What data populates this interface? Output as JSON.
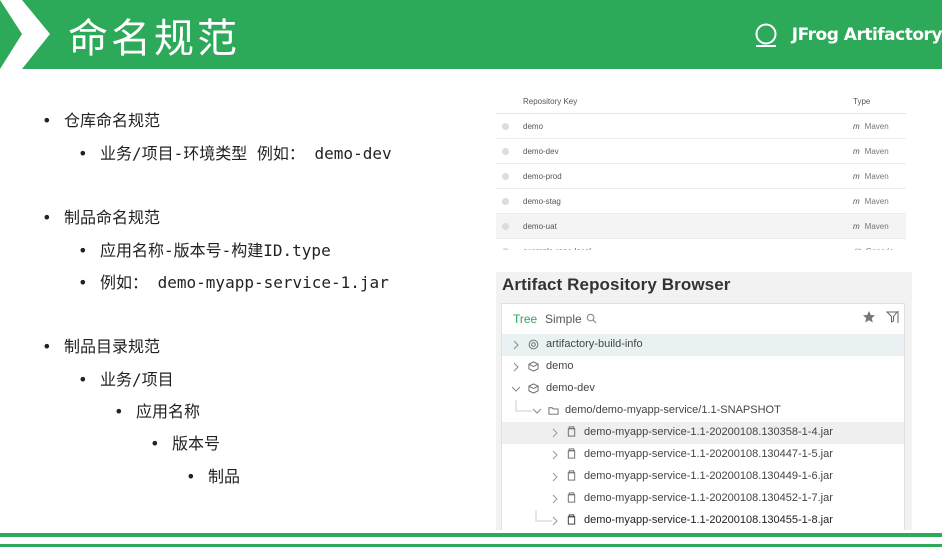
{
  "header": {
    "title": "命名规范",
    "brand": "JFrog Artifactory",
    "accent": "#2da95a"
  },
  "bullets": [
    {
      "text": "仓库命名规范"
    },
    {
      "text": "业务/项目-环境类型   例如： demo-dev"
    },
    {
      "text": "制品命名规范"
    },
    {
      "text": "应用名称-版本号-构建ID.type"
    },
    {
      "text": "例如： demo-myapp-service-1.jar"
    },
    {
      "text": "制品目录规范"
    },
    {
      "text": "业务/项目"
    },
    {
      "text": "应用名称"
    },
    {
      "text": "版本号"
    },
    {
      "text": "制品"
    }
  ],
  "repo_table": {
    "col_key": "Repository Key",
    "col_type": "Type",
    "rows": [
      {
        "key": "demo",
        "type": "Maven",
        "type_icon": "maven-icon"
      },
      {
        "key": "demo-dev",
        "type": "Maven",
        "type_icon": "maven-icon"
      },
      {
        "key": "demo-prod",
        "type": "Maven",
        "type_icon": "maven-icon"
      },
      {
        "key": "demo-stag",
        "type": "Maven",
        "type_icon": "maven-icon"
      },
      {
        "key": "demo-uat",
        "type": "Maven",
        "type_icon": "maven-icon"
      },
      {
        "key": "example-repo-local",
        "type": "Generic",
        "type_icon": "generic-icon"
      }
    ]
  },
  "browser": {
    "title": "Artifact Repository Browser",
    "tab_tree": "Tree",
    "tab_simple": "Simple",
    "nodes": [
      {
        "label": "artifactory-build-info",
        "icon": "build-info-icon"
      },
      {
        "label": "demo",
        "icon": "repo-icon"
      },
      {
        "label": "demo-dev",
        "icon": "repo-icon"
      },
      {
        "label": "demo/demo-myapp-service/1.1-SNAPSHOT",
        "icon": "folder-icon"
      },
      {
        "label": "demo-myapp-service-1.1-20200108.130358-1-4.jar",
        "icon": "jar-icon"
      },
      {
        "label": "demo-myapp-service-1.1-20200108.130447-1-5.jar",
        "icon": "jar-icon"
      },
      {
        "label": "demo-myapp-service-1.1-20200108.130449-1-6.jar",
        "icon": "jar-icon"
      },
      {
        "label": "demo-myapp-service-1.1-20200108.130452-1-7.jar",
        "icon": "jar-icon"
      },
      {
        "label": "demo-myapp-service-1.1-20200108.130455-1-8.jar",
        "icon": "jar-icon"
      }
    ]
  }
}
